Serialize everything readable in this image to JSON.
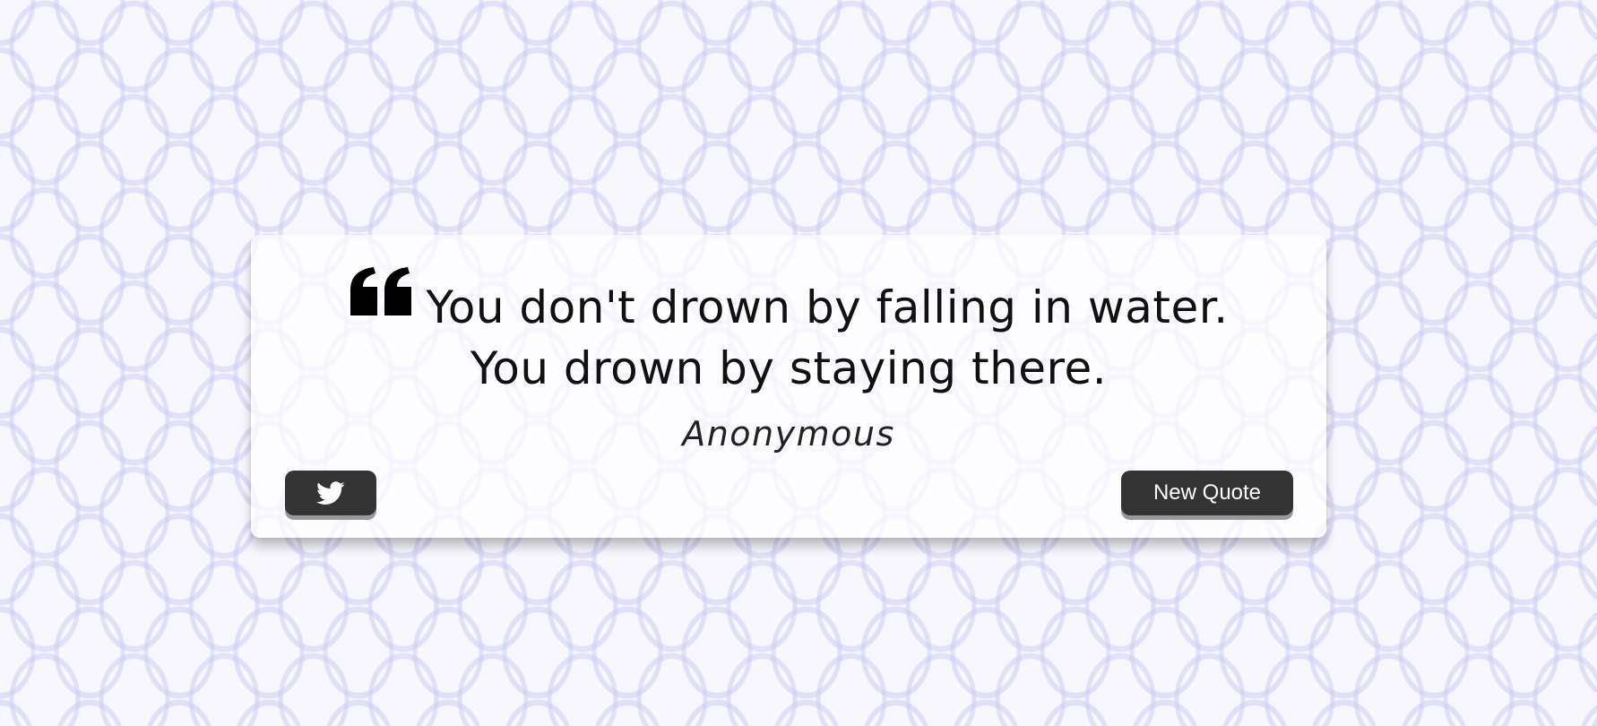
{
  "quote": {
    "text": "You don't drown by falling in water. You drown by staying there.",
    "author": "Anonymous",
    "icon": "quote-left-icon"
  },
  "buttons": {
    "tweet_icon": "twitter-icon",
    "new_quote_label": "New Quote"
  }
}
